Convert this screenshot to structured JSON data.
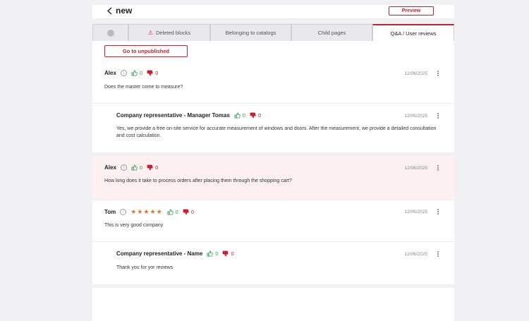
{
  "header": {
    "title": "new",
    "preview_label": "Preview"
  },
  "tabs": [
    {
      "label": ""
    },
    {
      "label": "Deleted blocks"
    },
    {
      "label": "Belonging to catalogs"
    },
    {
      "label": "Child pages"
    },
    {
      "label": "Q&A / User reviews"
    }
  ],
  "actions": {
    "unpublished_label": "Go to unpublished"
  },
  "reviews": [
    {
      "author": "Alex",
      "likes": "0",
      "dislikes": "0",
      "date": "12/06/2025",
      "text": "Does the master come to measure?"
    },
    {
      "author": "Company representative - Manager Tomas",
      "likes": "0",
      "dislikes": "0",
      "date": "12/06/2025",
      "text": "Yes, we provide a free on-site service for accurate measurement of windows and doors. After the measurement, we provide a detailed consultation and cost calculation."
    },
    {
      "author": "Alex",
      "likes": "0",
      "dislikes": "0",
      "date": "12/06/2025",
      "text": "How long does it take to process orders after placing them through the shopping cart?"
    },
    {
      "author": "Tom",
      "rating": 5,
      "stars": "★★★★★",
      "likes": "0",
      "dislikes": "0",
      "date": "12/06/2025",
      "text": "This is very good company"
    },
    {
      "author": "Company representative - Name",
      "likes": "0",
      "dislikes": "0",
      "date": "12/06/2025",
      "text": "Thank you for yor reviews"
    }
  ],
  "colors": {
    "accent": "#c4202f",
    "like": "#2e9e4f",
    "star": "#e8732b",
    "highlight": "#fdf0f0"
  }
}
